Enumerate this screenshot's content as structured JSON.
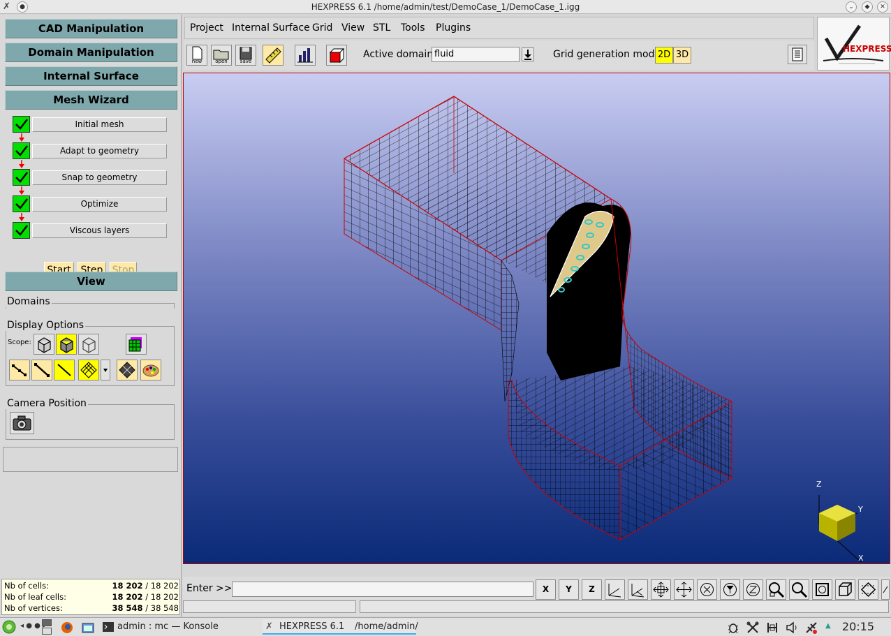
{
  "window": {
    "title": "HEXPRESS 6.1      /home/admin/test/DemoCase_1/DemoCase_1.igg"
  },
  "left_panel": {
    "sections": {
      "cad": "CAD Manipulation",
      "domain": "Domain Manipulation",
      "internal_surface": "Internal Surface",
      "mesh_wizard": "Mesh Wizard",
      "view": "View"
    },
    "steps": [
      {
        "label": "Initial mesh",
        "done": true
      },
      {
        "label": "Adapt to geometry",
        "done": true
      },
      {
        "label": "Snap to geometry",
        "done": true
      },
      {
        "label": "Optimize",
        "done": true
      },
      {
        "label": "Viscous layers",
        "done": true
      }
    ],
    "controls": {
      "start": "Start",
      "step": "Step",
      "stop": "Stop"
    },
    "groups": {
      "domains": "Domains",
      "display_options": "Display Options",
      "scope": "Scope:",
      "camera_position": "Camera Position"
    },
    "stats": [
      {
        "label": "Nb of cells:",
        "value": "18 202",
        "total": "/ 18 202"
      },
      {
        "label": "Nb of leaf cells:",
        "value": "18 202",
        "total": "/ 18 202"
      },
      {
        "label": "Nb of vertices:",
        "value": "38 548",
        "total": "/ 38 548"
      }
    ]
  },
  "menubar": {
    "items": [
      "Project",
      "Internal Surface",
      "Grid",
      "View",
      "STL",
      "Tools",
      "Plugins"
    ]
  },
  "toolbar": {
    "new_label": "new",
    "open_label": "open",
    "save_label": "save",
    "active_domain_label": "Active domain:",
    "active_domain_value": "fluid",
    "grid_mode_label": "Grid generation mode:",
    "mode_2d": "2D",
    "mode_3d": "3D"
  },
  "logo": {
    "text": "HEXPRESS"
  },
  "axes": {
    "z": "Z",
    "y": "Y",
    "x": "X"
  },
  "command": {
    "label": "Enter >>",
    "value": "",
    "view_buttons": [
      "X",
      "Y",
      "Z"
    ]
  },
  "taskbar": {
    "konsole": "admin : mc — Konsole",
    "hexpress": "HEXPRESS 6.1",
    "hexpress_path": "/home/admin/",
    "clock": "20:15"
  },
  "colors": {
    "section": "#7fa8ac",
    "check": "#00e000",
    "highlight": "#ffff00",
    "cream": "#ffe9a6",
    "mesh_edge": "#cc0000"
  }
}
